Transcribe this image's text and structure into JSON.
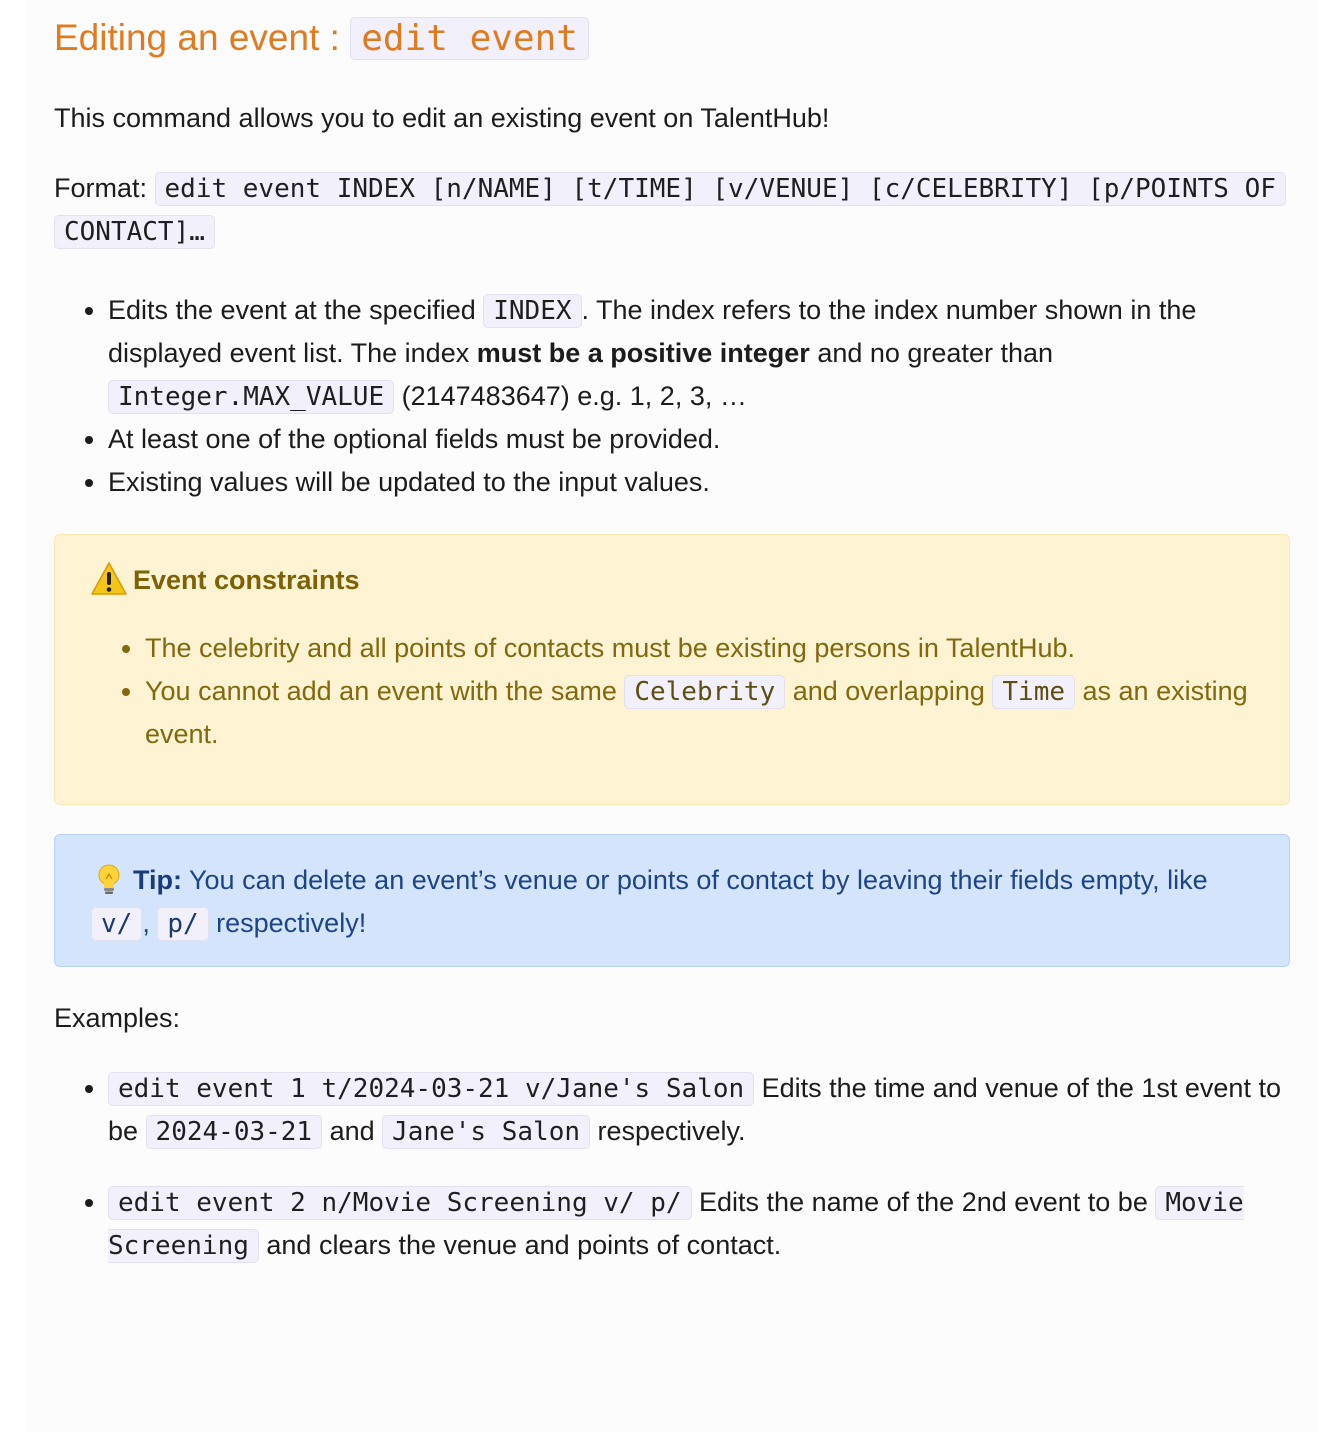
{
  "heading": {
    "text": "Editing an event : ",
    "code": "edit event"
  },
  "intro": "This command allows you to edit an existing event on TalentHub!",
  "format": {
    "label": "Format: ",
    "code": "edit event INDEX [n/NAME] [t/TIME] [v/VENUE] [c/CELEBRITY] [p/POINTS OF CONTACT]…"
  },
  "bullets": {
    "b1": {
      "t1": "Edits the event at the specified ",
      "c1": "INDEX",
      "t2": ". The index refers to the index number shown in the displayed event list. The index ",
      "bold": "must be a positive integer",
      "t3": " and no greater than ",
      "c2": "Integer.MAX_VALUE",
      "t4": " (2147483647) e.g. 1, 2, 3, …"
    },
    "b2": "At least one of the optional fields must be provided.",
    "b3": "Existing values will be updated to the input values."
  },
  "warning": {
    "title": "Event constraints",
    "items": {
      "i1": "The celebrity and all points of contacts must be existing persons in TalentHub.",
      "i2": {
        "t1": "You cannot add an event with the same ",
        "c1": "Celebrity",
        "t2": " and overlapping ",
        "c2": "Time",
        "t3": " as an existing event."
      }
    }
  },
  "tip": {
    "label": "Tip:",
    "t1": " You can delete an event’s venue or points of contact by leaving their fields empty, like ",
    "c1": "v/",
    "t2": ", ",
    "c2": "p/",
    "t3": " respectively!"
  },
  "examples": {
    "label": "Examples:",
    "e1": {
      "c1": "edit event 1 t/2024-03-21 v/Jane's Salon",
      "t1": " Edits the time and venue of the 1st event to be ",
      "c2": "2024-03-21",
      "t2": " and ",
      "c3": "Jane's Salon",
      "t3": " respectively."
    },
    "e2": {
      "c1": "edit event 2 n/Movie Screening v/ p/",
      "t1": " Edits the name of the 2nd event to be ",
      "c2": "Movie Screening",
      "t2": " and clears the venue and points of contact."
    }
  },
  "colors": {
    "heading": "#e07b20",
    "warning_bg": "#fef3d2",
    "warning_text": "#84680f",
    "tip_bg": "#d4e4fc",
    "tip_text": "#1d4486"
  },
  "icons": {
    "warning": "warning-icon",
    "tip": "lightbulb-icon"
  }
}
